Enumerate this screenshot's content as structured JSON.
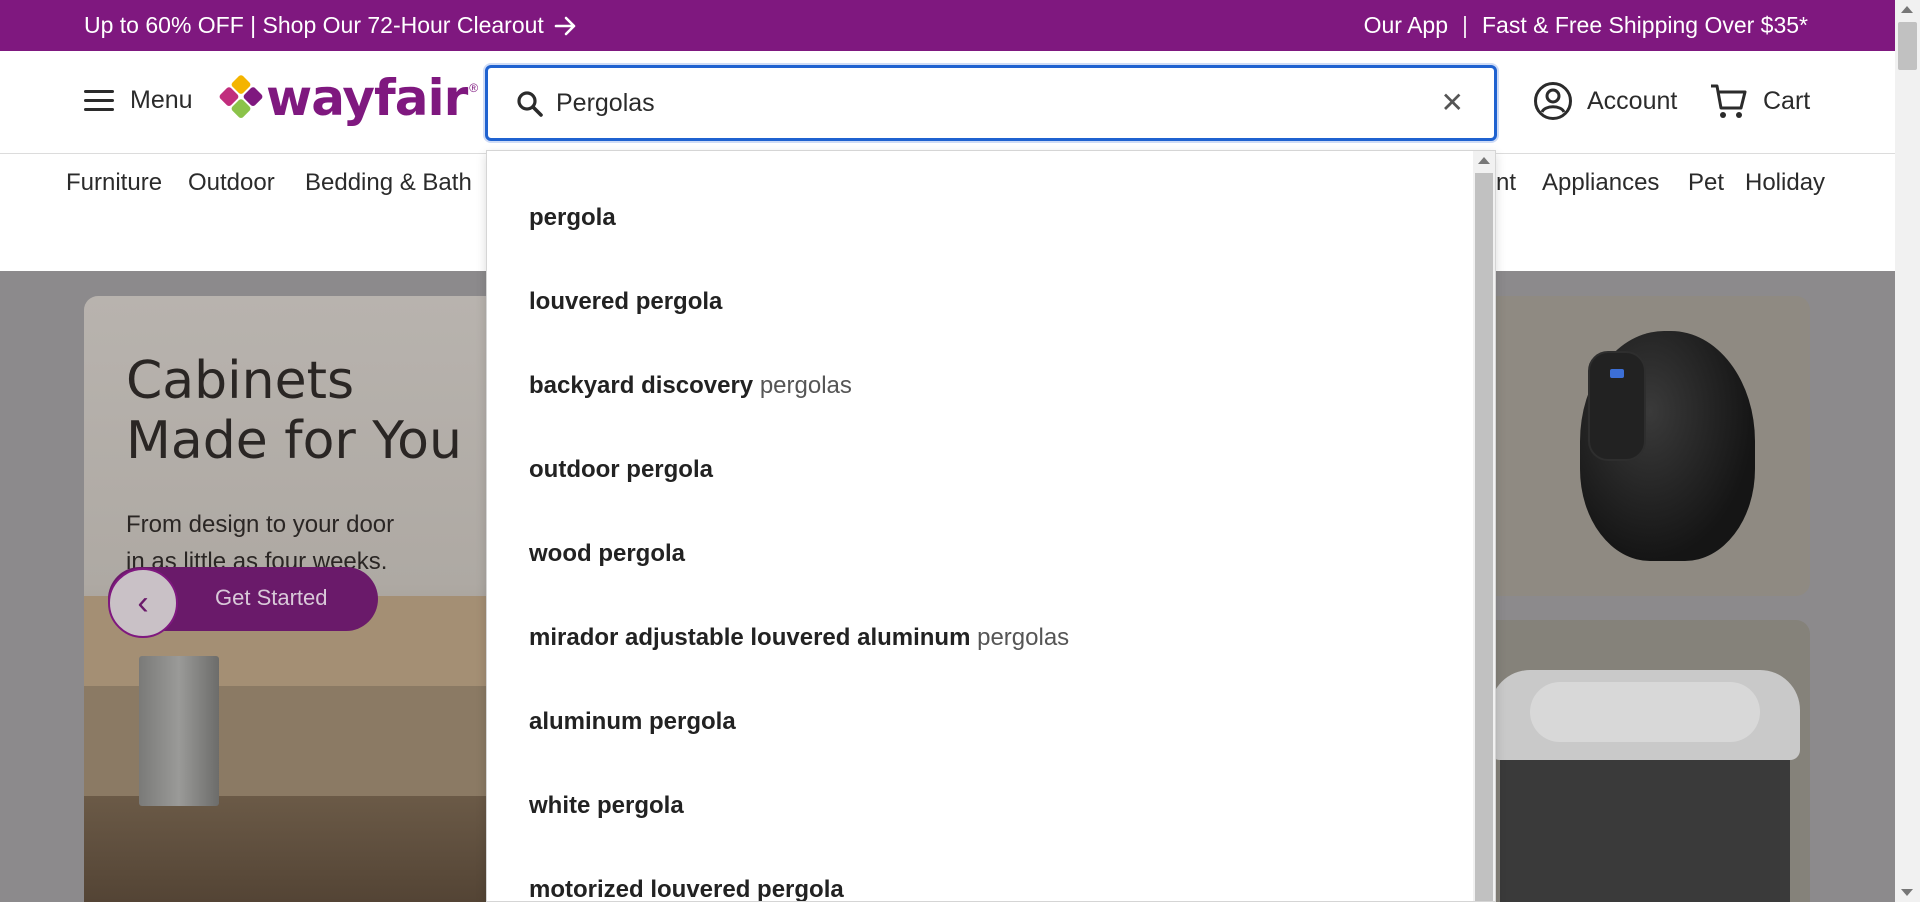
{
  "promo": {
    "left_text": "Up to 60% OFF | Shop Our 72-Hour Clearout",
    "app_link": "Our App",
    "separator": "|",
    "shipping": "Fast & Free Shipping Over $35*"
  },
  "header": {
    "menu_label": "Menu",
    "logo_text": "wayfair",
    "logo_reg": "®",
    "logo_colors": [
      "#f4b400",
      "#7f187f",
      "#c12d7d",
      "#8bc34a"
    ],
    "search_value": "Pergolas",
    "clear_glyph": "✕",
    "account_label": "Account",
    "cart_label": "Cart",
    "brand_color": "#7f187f",
    "focus_color": "#1f62d0"
  },
  "nav": {
    "items": [
      "Furniture",
      "Outdoor",
      "Bedding & Bath",
      "nt",
      "Appliances",
      "Pet",
      "Holiday"
    ]
  },
  "hero": {
    "title_line1": "Cabinets",
    "title_line2": "Made for You",
    "subtitle_line1": "From design to your door",
    "subtitle_line2": "in as little as four weeks.",
    "cta_label": "Get Started",
    "back_glyph": "‹"
  },
  "suggestions": [
    {
      "bold": "pergola",
      "rest": ""
    },
    {
      "bold": "louvered pergola",
      "rest": ""
    },
    {
      "bold": "backyard discovery",
      "rest": "pergolas"
    },
    {
      "bold": "outdoor pergola",
      "rest": ""
    },
    {
      "bold": "wood pergola",
      "rest": ""
    },
    {
      "bold": "mirador adjustable louvered aluminum",
      "rest": "pergolas"
    },
    {
      "bold": "aluminum pergola",
      "rest": ""
    },
    {
      "bold": "white pergola",
      "rest": ""
    },
    {
      "bold": "motorized louvered pergola",
      "rest": ""
    }
  ]
}
